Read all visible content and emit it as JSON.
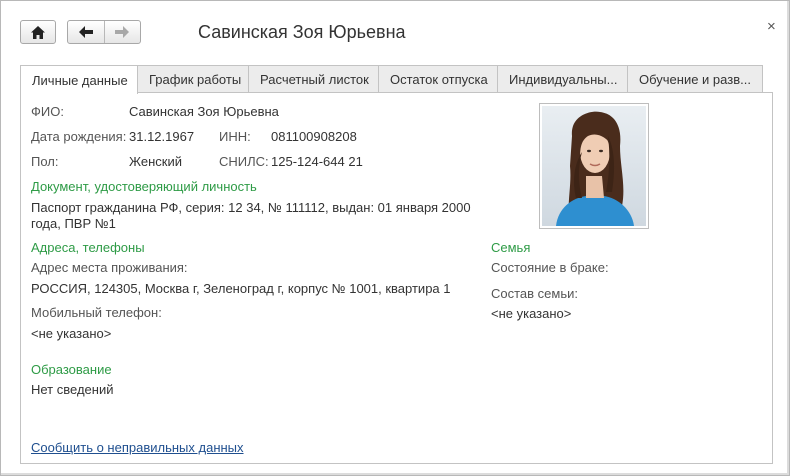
{
  "window": {
    "title": "Савинская Зоя Юрьевна",
    "close_glyph": "×"
  },
  "toolbar": {
    "home_icon": "home-icon",
    "back_icon": "arrow-left-icon",
    "forward_icon": "arrow-right-icon"
  },
  "tabs": [
    {
      "label": "Личные данные",
      "active": true
    },
    {
      "label": "График работы",
      "active": false
    },
    {
      "label": "Расчетный листок",
      "active": false
    },
    {
      "label": "Остаток отпуска",
      "active": false
    },
    {
      "label": "Индивидуальны...",
      "active": false
    },
    {
      "label": "Обучение и разв...",
      "active": false
    }
  ],
  "personal": {
    "fio_label": "ФИО:",
    "fio_value": "Савинская Зоя Юрьевна",
    "birth_label": "Дата рождения:",
    "birth_value": "31.12.1967",
    "inn_label": "ИНН:",
    "inn_value": "081100908208",
    "sex_label": "Пол:",
    "sex_value": "Женский",
    "snils_label": "СНИЛС:",
    "snils_value": "125-124-644 21"
  },
  "document": {
    "heading": "Документ, удостоверяющий личность",
    "value": "Паспорт гражданина РФ, серия: 12 34, № 111112, выдан: 01 января 2000 года, ПВР №1"
  },
  "contacts": {
    "heading": "Адреса, телефоны",
    "address_label": "Адрес места проживания:",
    "address_value": "РОССИЯ, 124305, Москва г, Зеленоград г, корпус № 1001, квартира 1",
    "mobile_label": "Мобильный телефон:",
    "mobile_value": "<не указано>"
  },
  "education": {
    "heading": "Образование",
    "value": "Нет сведений"
  },
  "family": {
    "heading": "Семья",
    "marital_label": "Состояние в браке:",
    "composition_label": "Состав семьи:",
    "composition_value": "<не указано>"
  },
  "report_link": "Сообщить о неправильных данных"
}
